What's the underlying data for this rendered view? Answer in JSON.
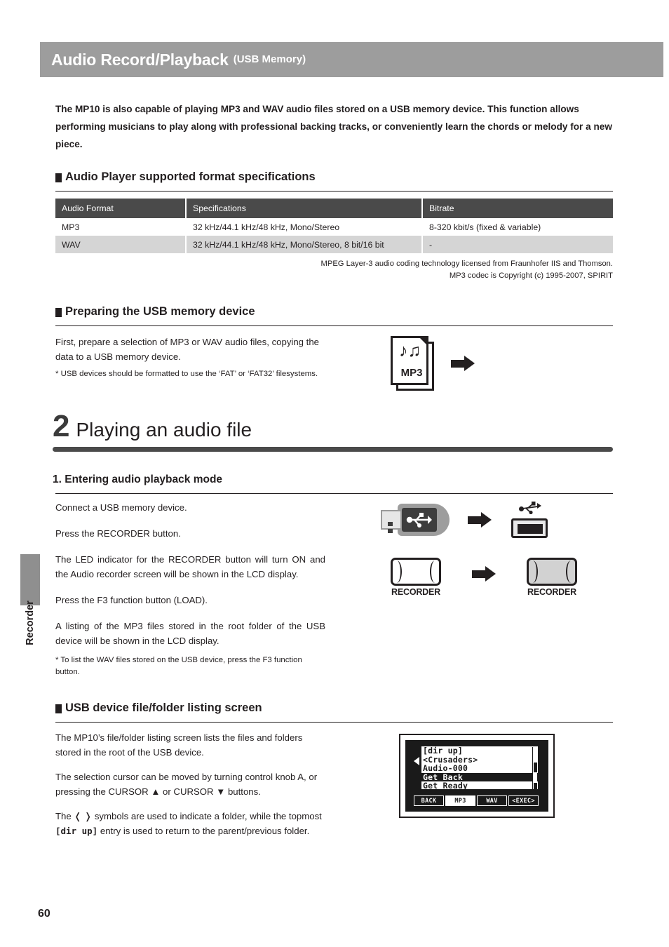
{
  "header": {
    "title": "Audio Record/Playback",
    "subtitle": "(USB Memory)",
    "bg_color": "#9d9d9d"
  },
  "intro": "The MP10 is also capable of playing MP3 and WAV audio files stored on a USB memory device.  This function allows performing musicians to play along with professional backing tracks, or conveniently learn the chords or melody for a new piece.",
  "spec_section": {
    "heading": "Audio Player supported format specifications",
    "table": {
      "headers": [
        "Audio Format",
        "Specifications",
        "Bitrate"
      ],
      "rows": [
        [
          "MP3",
          "32 kHz/44.1 kHz/48 kHz, Mono/Stereo",
          "8-320 kbit/s (fixed & variable)"
        ],
        [
          "WAV",
          "32 kHz/44.1 kHz/48 kHz, Mono/Stereo, 8 bit/16 bit",
          "-"
        ]
      ],
      "header_bg": "#4a4a4a",
      "alt_row_bg": "#d5d5d5"
    },
    "notes": [
      "MPEG Layer-3 audio coding technology licensed from Fraunhofer IIS and Thomson.",
      "MP3 codec is Copyright (c) 1995-2007, SPIRIT"
    ]
  },
  "prepare_section": {
    "heading": "Preparing the USB memory device",
    "paragraph": "First, prepare a selection of MP3 or WAV audio files, copying the data to a USB memory device.",
    "note": "* USB devices should be formatted to use the ‘FAT’ or ‘FAT32’ filesystems.",
    "illustration": {
      "file_label": "MP3",
      "notes_glyph": "♪♫"
    }
  },
  "big_section": {
    "number": "2",
    "title": "Playing an audio file"
  },
  "step_section": {
    "heading": "1. Entering audio playback mode",
    "steps": [
      "Connect a USB memory device.",
      "Press the RECORDER button.",
      "The LED indicator for the RECORDER button will turn ON and the Audio recorder screen will be shown in the LCD display.",
      "Press the F3 function button (LOAD).",
      "A listing of the MP3 files stored in the root folder of the USB device will be shown in the LCD display."
    ],
    "note": "* To list the WAV files stored on the USB device, press the F3 function button.",
    "illustration": {
      "recorder_label_off": "RECORDER",
      "recorder_label_on": "RECORDER"
    }
  },
  "listing_section": {
    "heading": "USB device file/folder listing screen",
    "paragraphs": [
      "The MP10’s file/folder listing screen lists the files and folders stored in the root of the USB device.",
      "The selection cursor can be moved by turning control knob A, or pressing the CURSOR ▲ or CURSOR ▼ buttons."
    ],
    "folder_note_pre": "The ",
    "folder_note_symbols": "❬ ❭",
    "folder_note_mid": " symbols are used to indicate a folder, while the topmost ",
    "folder_note_mono": "[dir up]",
    "folder_note_end": " entry is used to return to the parent/previous folder."
  },
  "lcd": {
    "items": [
      {
        "text": "[dir up]",
        "selected": false
      },
      {
        "text": "<Crusaders>",
        "selected": false
      },
      {
        "text": "Audio-000",
        "selected": false
      },
      {
        "text": "Get Back",
        "selected": true
      },
      {
        "text": "Get Ready",
        "selected": false
      }
    ],
    "function_keys": [
      {
        "label": "BACK",
        "active": false
      },
      {
        "label": "MP3",
        "active": true
      },
      {
        "label": "WAV",
        "active": false
      },
      {
        "label": "<EXEC>",
        "active": false
      }
    ]
  },
  "sidebar": {
    "label": "Recorder",
    "tab_color": "#8f8f8f"
  },
  "page_number": "60"
}
